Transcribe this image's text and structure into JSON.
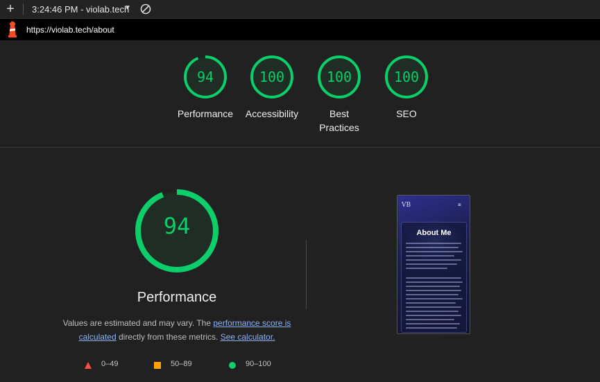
{
  "topbar": {
    "add_icon": "plus-icon",
    "time_text": "3:24:46 PM - violab.tech",
    "dropdown_icon": "caret-down-icon",
    "block_icon": "block-icon"
  },
  "urlbar": {
    "logo_icon": "lighthouse-icon",
    "url": "https://violab.tech/about"
  },
  "summary": {
    "gauges": [
      {
        "score": "94",
        "label": "Performance"
      },
      {
        "score": "100",
        "label": "Accessibility"
      },
      {
        "score": "100",
        "label": "Best Practices"
      },
      {
        "score": "100",
        "label": "SEO"
      }
    ]
  },
  "performance": {
    "score": "94",
    "title": "Performance",
    "desc_part1": "Values are estimated and may vary. The ",
    "link1": "performance score is calculated",
    "desc_part2": " directly from these metrics. ",
    "link2": "See calculator."
  },
  "legend": {
    "fail": "0–49",
    "average": "50–89",
    "pass": "90–100"
  },
  "colors": {
    "pass": "#0cce6b",
    "average": "#ffa400",
    "fail": "#ff4e42",
    "link": "#8ab4f8"
  },
  "screenshot": {
    "logo": "VB",
    "menu_icon": "hamburger-icon",
    "title": "About Me"
  }
}
